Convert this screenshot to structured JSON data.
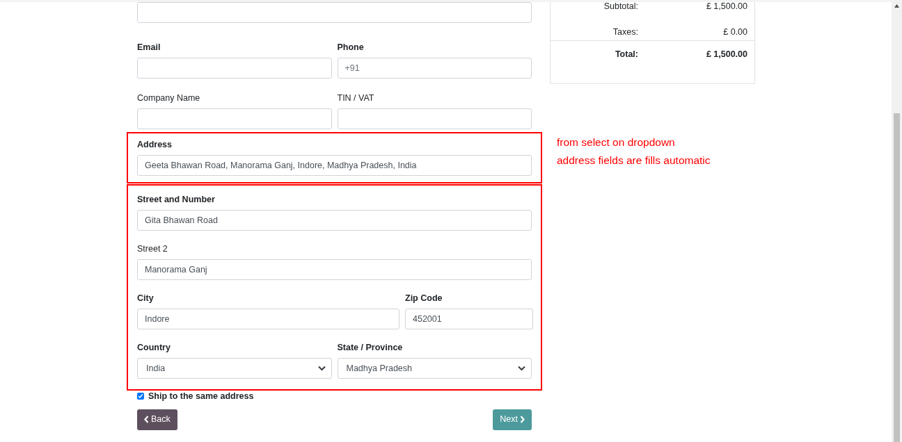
{
  "form": {
    "rows": [
      [
        {
          "kind": "input"
        }
      ],
      [
        {
          "kind": "input",
          "label": "Email",
          "required": true
        },
        {
          "kind": "input",
          "label": "Phone",
          "required": true,
          "placeholder": "+91"
        }
      ],
      [
        {
          "kind": "input",
          "label": "Company Name",
          "required": false
        },
        {
          "kind": "input",
          "label": "TIN / VAT",
          "required": false
        }
      ]
    ]
  },
  "address_group": {
    "rows": [
      [
        {
          "kind": "input",
          "label": "Address",
          "required": true,
          "value": "Geeta Bhawan Road, Manorama Ganj, Indore, Madhya Pradesh, India"
        }
      ]
    ]
  },
  "details_group": {
    "rows": [
      [
        {
          "kind": "input",
          "label": "Street and Number",
          "required": true,
          "value": "Gita Bhawan Road"
        }
      ],
      [
        {
          "kind": "input",
          "label": "Street 2",
          "required": false,
          "value": "Manorama Ganj"
        }
      ],
      [
        {
          "kind": "input",
          "label": "City",
          "required": true,
          "value": "Indore"
        },
        {
          "kind": "input",
          "label": "Zip Code",
          "required": true,
          "value": "452001"
        }
      ],
      [
        {
          "kind": "select",
          "label": "Country",
          "required": true,
          "value": "India"
        },
        {
          "kind": "select",
          "label": "State / Province",
          "required": true,
          "value": "Madhya Pradesh"
        }
      ]
    ]
  },
  "ship_same": {
    "label": "Ship to the same address",
    "checked": true
  },
  "buttons": {
    "back": "Back",
    "next": "Next"
  },
  "summary": {
    "rows": [
      {
        "label": "Subtotal:",
        "value": "£ 1,500.00",
        "total": false
      },
      {
        "label": "Taxes:",
        "value": "£ 0.00",
        "total": false
      },
      {
        "label": "Total:",
        "value": "£ 1,500.00",
        "total": true
      }
    ]
  },
  "annotation": [
    "from select on dropdown",
    "address fields are fills automatic"
  ]
}
